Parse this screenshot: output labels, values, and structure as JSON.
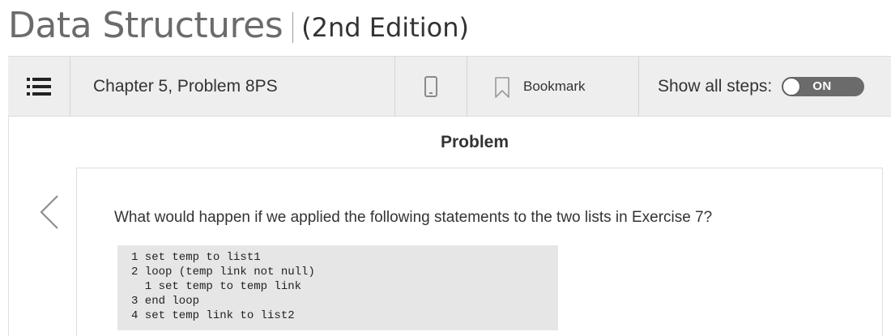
{
  "book": {
    "title": "Data Structures",
    "edition": "(2nd Edition)"
  },
  "toolbar": {
    "menu_icon": "list-menu-icon",
    "chapter_label": "Chapter 5, Problem 8PS",
    "mobile_icon": "mobile-phone-icon",
    "bookmark_icon": "bookmark-icon",
    "bookmark_label": "Bookmark",
    "show_steps_label": "Show all steps:",
    "toggle_state": "ON"
  },
  "problem": {
    "heading": "Problem",
    "prev_icon": "chevron-left-icon",
    "text": "What would happen if we applied the following statements to the two lists in Exercise 7?",
    "code": [
      "1 set temp to list1",
      "2 loop (temp link not null)",
      "  1 set temp to temp link",
      "3 end loop",
      "4 set temp link to list2"
    ]
  },
  "colors": {
    "toolbar_bg": "#eeeeee",
    "toggle_bg": "#6b6b6b",
    "code_bg": "#e6e6e6",
    "title_gray": "#6b6b6b"
  }
}
